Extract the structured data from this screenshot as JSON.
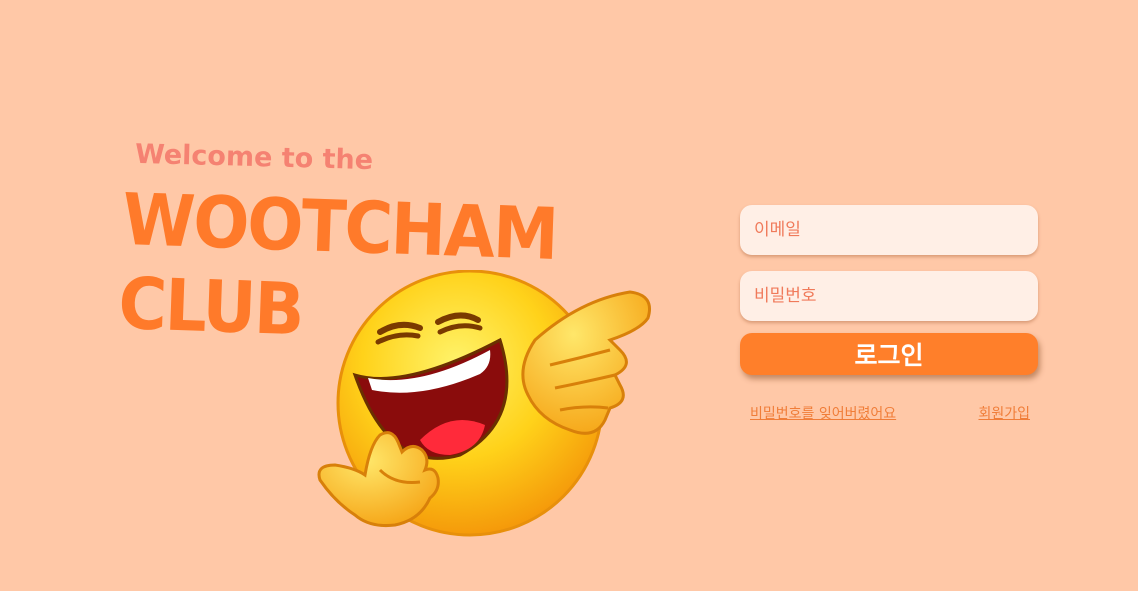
{
  "hero": {
    "welcome": "Welcome to the",
    "title_line1": "WOOTCHAM",
    "title_line2": "CLUB",
    "emoji": "laughing-pointing-emoji"
  },
  "login": {
    "email_placeholder": "이메일",
    "password_placeholder": "비밀번호",
    "login_label": "로그인",
    "forgot_password": "비밀번호를 잊어버렸어요",
    "signup": "회원가입"
  },
  "colors": {
    "background": "#ffc8a7",
    "title": "#ff7a2a",
    "welcome": "#f58272",
    "button": "#ff7f2a",
    "input_bg": "#ffefe6",
    "link": "#f07d38"
  }
}
